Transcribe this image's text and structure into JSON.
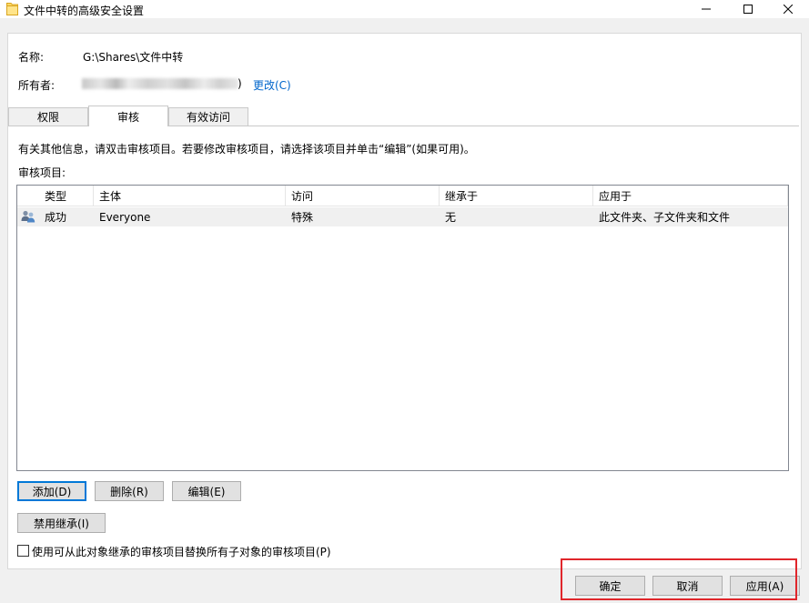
{
  "window": {
    "title": "文件中转的高级安全设置"
  },
  "info": {
    "name_label": "名称:",
    "name_value": "G:\\Shares\\文件中转",
    "owner_label": "所有者:",
    "owner_suffix": ")",
    "change_link": "更改(C)"
  },
  "tabs": [
    {
      "label": "权限"
    },
    {
      "label": "审核"
    },
    {
      "label": "有效访问"
    }
  ],
  "audit": {
    "instruction": "有关其他信息，请双击审核项目。若要修改审核项目，请选择该项目并单击“编辑”(如果可用)。",
    "list_label": "审核项目:",
    "columns": [
      "类型",
      "主体",
      "访问",
      "继承于",
      "应用于"
    ],
    "rows": [
      {
        "type": "成功",
        "principal": "Everyone",
        "access": "特殊",
        "inherited_from": "无",
        "applies_to": "此文件夹、子文件夹和文件",
        "icon": "users-icon"
      }
    ]
  },
  "buttons": {
    "add": "添加(D)",
    "remove": "删除(R)",
    "edit": "编辑(E)",
    "disable_inheritance": "禁用继承(I)",
    "ok": "确定",
    "cancel": "取消",
    "apply": "应用(A)"
  },
  "checkbox": {
    "label": "使用可从此对象继承的审核项目替换所有子对象的审核项目(P)",
    "checked": false
  },
  "colors": {
    "link": "#0066cc",
    "accent": "#0078d7",
    "highlight_box": "#e0262b"
  }
}
